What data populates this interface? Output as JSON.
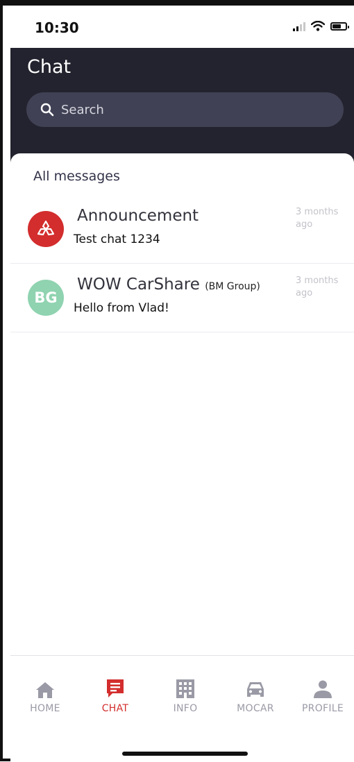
{
  "status_bar": {
    "time": "10:30"
  },
  "header": {
    "title": "Chat"
  },
  "search": {
    "placeholder": "Search"
  },
  "messages": {
    "section_label": "All messages",
    "items": [
      {
        "name": "Announcement",
        "group": "",
        "preview": "Test chat 1234",
        "time": "3 months ago",
        "avatar_icon": "announcement-logo-icon",
        "avatar_color": "#d32d2d"
      },
      {
        "name": "WOW CarShare",
        "group": "(BM Group)",
        "preview": "Hello from Vlad!",
        "time": "3 months ago",
        "avatar_initials": "BG",
        "avatar_color": "#8fd3b0"
      }
    ]
  },
  "tabs": [
    {
      "label": "HOME",
      "icon": "home-icon",
      "active": false
    },
    {
      "label": "CHAT",
      "icon": "chat-icon",
      "active": true
    },
    {
      "label": "INFO",
      "icon": "info-building-icon",
      "active": false
    },
    {
      "label": "MOCAR",
      "icon": "car-icon",
      "active": false
    },
    {
      "label": "PROFILE",
      "icon": "profile-icon",
      "active": false
    }
  ],
  "colors": {
    "header_bg": "#23232f",
    "search_bg": "#404154",
    "accent": "#d32d2d",
    "tab_inactive": "#9a9aa6"
  }
}
